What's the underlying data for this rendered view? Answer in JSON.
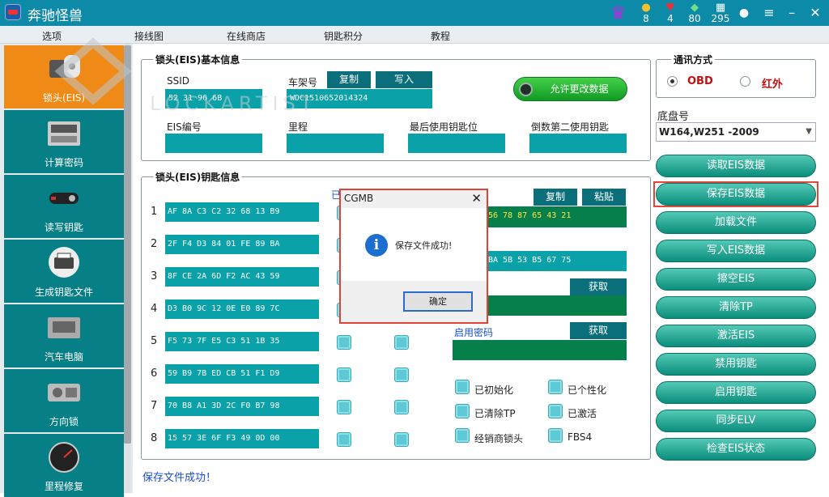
{
  "titlebar": {
    "title": "奔驰怪兽",
    "stats": [
      {
        "icon": "coin-icon",
        "value": "8"
      },
      {
        "icon": "heart-icon",
        "value": "4"
      },
      {
        "icon": "diamond-icon",
        "value": "80"
      },
      {
        "icon": "chip-icon",
        "value": "295"
      }
    ]
  },
  "menu": [
    "选项",
    "接线图",
    "在线商店",
    "钥匙积分",
    "教程"
  ],
  "sidebar": [
    {
      "label": "锁头(EIS)",
      "icon": "eis-lock-icon",
      "active": true
    },
    {
      "label": "计算密码",
      "icon": "calculator-device-icon"
    },
    {
      "label": "读写钥匙",
      "icon": "car-key-icon"
    },
    {
      "label": "生成钥匙文件",
      "icon": "printer-icon"
    },
    {
      "label": "汽车电脑",
      "icon": "ecu-icon"
    },
    {
      "label": "方向锁",
      "icon": "steering-lock-icon"
    },
    {
      "label": "里程修复",
      "icon": "speedometer-icon"
    }
  ],
  "basic": {
    "title": "锁头(EIS)基本信息",
    "ssid_label": "SSID",
    "ssid_value": "52 31 96 6B",
    "vin_label": "车架号",
    "copy": "复制",
    "write": "写入",
    "vin_value": "WDC1510652014324",
    "allow_btn": "允许更改数据",
    "eis_no": "EIS编号",
    "mileage": "里程",
    "last_key": "最后使用钥匙位",
    "second_key": "倒数第二使用钥匙"
  },
  "keys": {
    "title": "锁头(EIS)钥匙信息",
    "rows": [
      {
        "n": "1",
        "hex": "AF 8A C3 C2 32 68 13 B9"
      },
      {
        "n": "2",
        "hex": "2F F4 D3 84 01 FE 89 BA"
      },
      {
        "n": "3",
        "hex": "8F CE 2A 6D F2 AC 43 59"
      },
      {
        "n": "4",
        "hex": "D3 B0 9C 12 0E E0 89 7C"
      },
      {
        "n": "5",
        "hex": "F5 73 7F E5 C3 51 1B 35"
      },
      {
        "n": "6",
        "hex": "59 B9 7B ED CB 51 F1 D9"
      },
      {
        "n": "7",
        "hex": "70 B8 A1 3D 2C F0 B7 98"
      },
      {
        "n": "8",
        "hex": "15 57 3E 6F F3 49 0D 00"
      }
    ],
    "copy": "复制",
    "paste": "粘贴",
    "green1": "56 78 87 65 43 21",
    "cyan1": "BA 5B 53 B5 67 75",
    "fetch": "获取",
    "enable_pw": "启用密码",
    "flags": [
      "已初始化",
      "已个性化",
      "已清除TP",
      "已激活",
      "经销商锁头",
      "FBS4"
    ],
    "partial_label": "已"
  },
  "comm": {
    "title": "通讯方式",
    "obd": "OBD",
    "ir": "红外",
    "chassis_label": "底盘号",
    "chassis_value": "W164,W251  -2009"
  },
  "actions": [
    "读取EIS数据",
    "保存EIS数据",
    "加载文件",
    "写入EIS数据",
    "擦空EIS",
    "清除TP",
    "激活EIS",
    "禁用钥匙",
    "启用钥匙",
    "同步ELV",
    "检查EIS状态"
  ],
  "dialog": {
    "title": "CGMB",
    "message": "保存文件成功!",
    "ok": "确定"
  },
  "status": "保存文件成功！",
  "watermark": "LOCKARTIST",
  "colors": {
    "accent": "#0e8aa9",
    "teal": "#0aa1a8",
    "orange": "#f08a16",
    "green": "#077f4a"
  }
}
